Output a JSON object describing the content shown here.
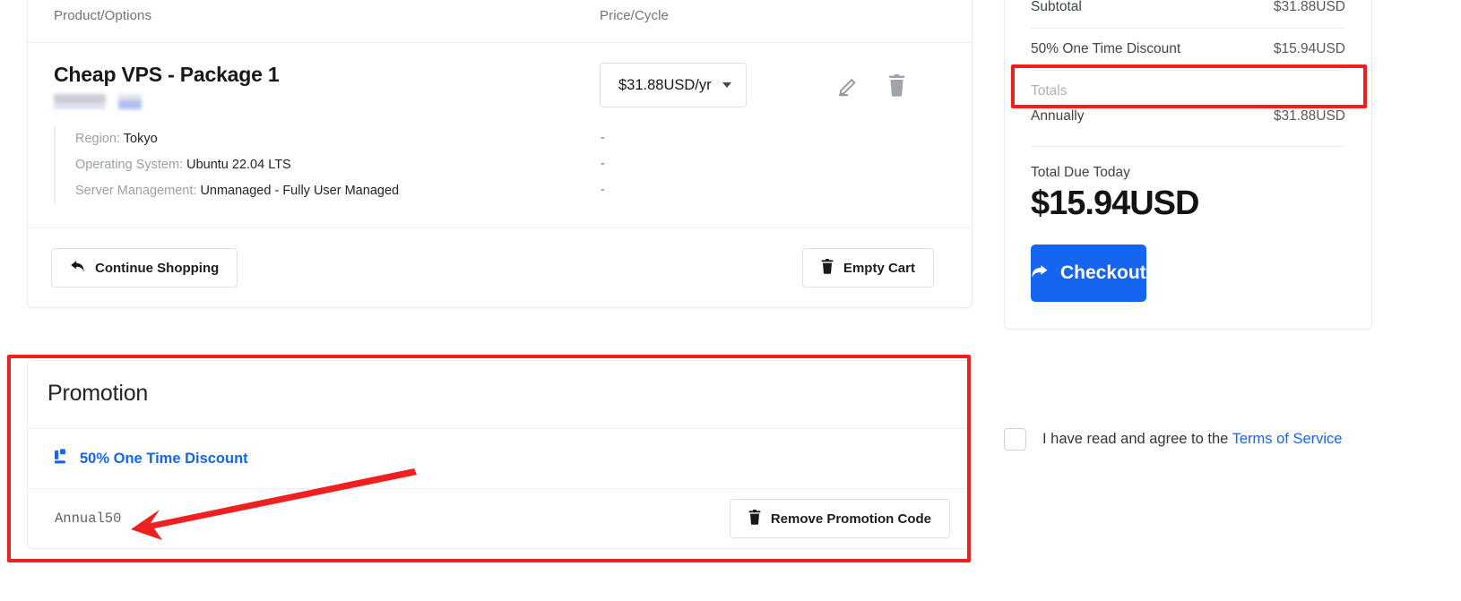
{
  "cart": {
    "columns": {
      "product": "Product/Options",
      "price": "Price/Cycle"
    },
    "item": {
      "title": "Cheap VPS - Package 1",
      "price_cycle": "$31.88USD/yr",
      "specs": [
        {
          "key": "Region:",
          "value": "Tokyo",
          "price": "-"
        },
        {
          "key": "Operating System:",
          "value": "Ubuntu 22.04 LTS",
          "price": "-"
        },
        {
          "key": "Server Management:",
          "value": "Unmanaged - Fully User Managed",
          "price": "-"
        }
      ],
      "edit_icon": "pencil-icon",
      "delete_icon": "trash-icon"
    },
    "continue_shopping": "Continue Shopping",
    "empty_cart": "Empty Cart"
  },
  "promotion": {
    "heading": "Promotion",
    "discount_link": "50% One Time Discount",
    "discount_icon": "promotion-tag-icon",
    "code": "Annual50",
    "remove_button": "Remove Promotion Code"
  },
  "summary": {
    "subtotal_label": "Subtotal",
    "subtotal_value": "$31.88USD",
    "discount_label": "50% One Time Discount",
    "discount_value": "$15.94USD",
    "totals_label": "Totals",
    "annually_label": "Annually",
    "annually_value": "$31.88USD",
    "due_label": "Total Due Today",
    "due_amount": "$15.94USD",
    "checkout_label": "Checkout"
  },
  "terms": {
    "text": "I have read and agree to the ",
    "link": "Terms of Service"
  },
  "colors": {
    "accent_blue": "#1565f0",
    "highlight_red": "#f01f1f",
    "muted_gray": "#9aa0a6"
  }
}
